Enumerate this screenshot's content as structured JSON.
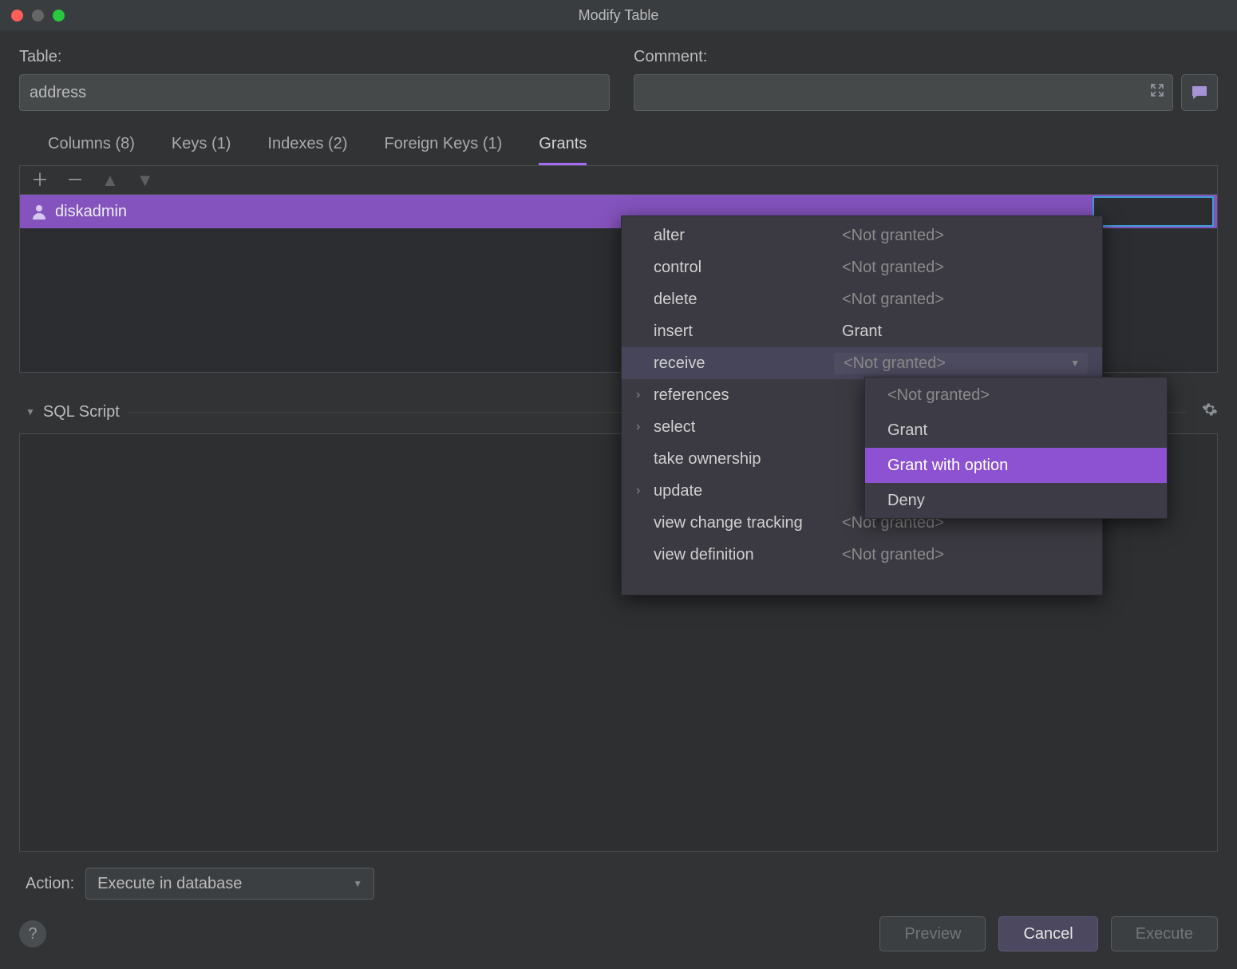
{
  "window": {
    "title": "Modify Table"
  },
  "form": {
    "table_label": "Table:",
    "table_value": "address",
    "comment_label": "Comment:",
    "comment_value": ""
  },
  "tabs": {
    "columns": "Columns (8)",
    "keys": "Keys (1)",
    "indexes": "Indexes (2)",
    "foreign_keys": "Foreign Keys (1)",
    "grants": "Grants"
  },
  "grantee": {
    "name": "diskadmin"
  },
  "permissions": [
    {
      "expand": "",
      "name": "alter",
      "status": "<Not granted>",
      "grant": false
    },
    {
      "expand": "",
      "name": "control",
      "status": "<Not granted>",
      "grant": false
    },
    {
      "expand": "",
      "name": "delete",
      "status": "<Not granted>",
      "grant": false
    },
    {
      "expand": "",
      "name": "insert",
      "status": "Grant",
      "grant": true
    },
    {
      "expand": "",
      "name": "receive",
      "status": "<Not granted>",
      "grant": false,
      "selected": true
    },
    {
      "expand": "›",
      "name": "references",
      "status": "",
      "grant": false
    },
    {
      "expand": "›",
      "name": "select",
      "status": "",
      "grant": false
    },
    {
      "expand": "",
      "name": "take ownership",
      "status": "",
      "grant": false
    },
    {
      "expand": "›",
      "name": "update",
      "status": "",
      "grant": false
    },
    {
      "expand": "",
      "name": "view change tracking",
      "status": "<Not granted>",
      "grant": false
    },
    {
      "expand": "",
      "name": "view definition",
      "status": "<Not granted>",
      "grant": false
    }
  ],
  "dropdown_options": {
    "not_granted": "<Not granted>",
    "grant": "Grant",
    "grant_with_option": "Grant with option",
    "deny": "Deny"
  },
  "script": {
    "header": "SQL Script"
  },
  "action": {
    "label": "Action:",
    "selected": "Execute in database"
  },
  "buttons": {
    "preview": "Preview",
    "cancel": "Cancel",
    "execute": "Execute",
    "help": "?"
  }
}
